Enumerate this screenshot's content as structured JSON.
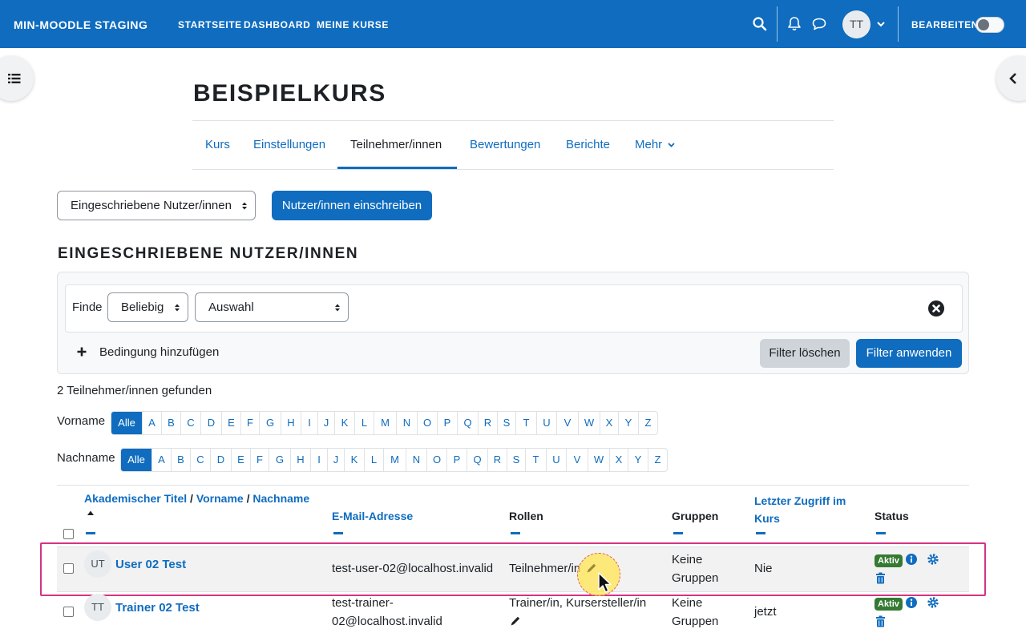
{
  "navbar": {
    "brand": "MIN-MOODLE STAGING",
    "links": [
      "STARTSEITE",
      "DASHBOARD",
      "MEINE KURSE"
    ],
    "avatar_initials": "TT",
    "edit_label": "BEARBEITEN"
  },
  "course": {
    "title": "BEISPIELKURS",
    "tabs": [
      "Kurs",
      "Einstellungen",
      "Teilnehmer/innen",
      "Bewertungen",
      "Berichte",
      "Mehr"
    ]
  },
  "toolbar": {
    "enrolled_select": "Eingeschriebene Nutzer/innen",
    "enrol_button": "Nutzer/innen einschreiben"
  },
  "section_title": "EINGESCHRIEBENE NUTZER/INNEN",
  "filter": {
    "label": "Finde",
    "match_select": "Beliebig",
    "type_select": "Auswahl",
    "add_condition": "Bedingung hinzufügen",
    "clear_button": "Filter löschen",
    "apply_button": "Filter anwenden"
  },
  "found_text": "2 Teilnehmer/innen gefunden",
  "initials": {
    "firstname_label": "Vorname",
    "lastname_label": "Nachname",
    "all_label": "Alle",
    "letters": [
      "A",
      "B",
      "C",
      "D",
      "E",
      "F",
      "G",
      "H",
      "I",
      "J",
      "K",
      "L",
      "M",
      "N",
      "O",
      "P",
      "Q",
      "R",
      "S",
      "T",
      "U",
      "V",
      "W",
      "X",
      "Y",
      "Z"
    ]
  },
  "table": {
    "headers": {
      "title_link": "Akademischer Titel",
      "firstname_link": "Vorname",
      "lastname_link": "Nachname",
      "separator": "/",
      "email": "E-Mail-Adresse",
      "roles": "Rollen",
      "groups": "Gruppen",
      "last_access_line1": "Letzter Zugriff im",
      "last_access_line2": "Kurs",
      "status": "Status"
    },
    "rows": [
      {
        "initials": "UT",
        "name": "User 02 Test",
        "email": "test-user-02@localhost.invalid",
        "roles": "Teilnehmer/in",
        "groups_line1": "Keine",
        "groups_line2": "Gruppen",
        "last_access": "Nie",
        "status": "Aktiv"
      },
      {
        "initials": "TT",
        "name": "Trainer 02 Test",
        "email_line1": "test-trainer-",
        "email_line2": "02@localhost.invalid",
        "roles": "Trainer/in, Kursersteller/in",
        "groups_line1": "Keine",
        "groups_line2": "Gruppen",
        "last_access": "jetzt",
        "status": "Aktiv"
      }
    ]
  },
  "colors": {
    "primary": "#0f6cbf",
    "badge_success": "#357a32",
    "highlight": "#d63384"
  }
}
